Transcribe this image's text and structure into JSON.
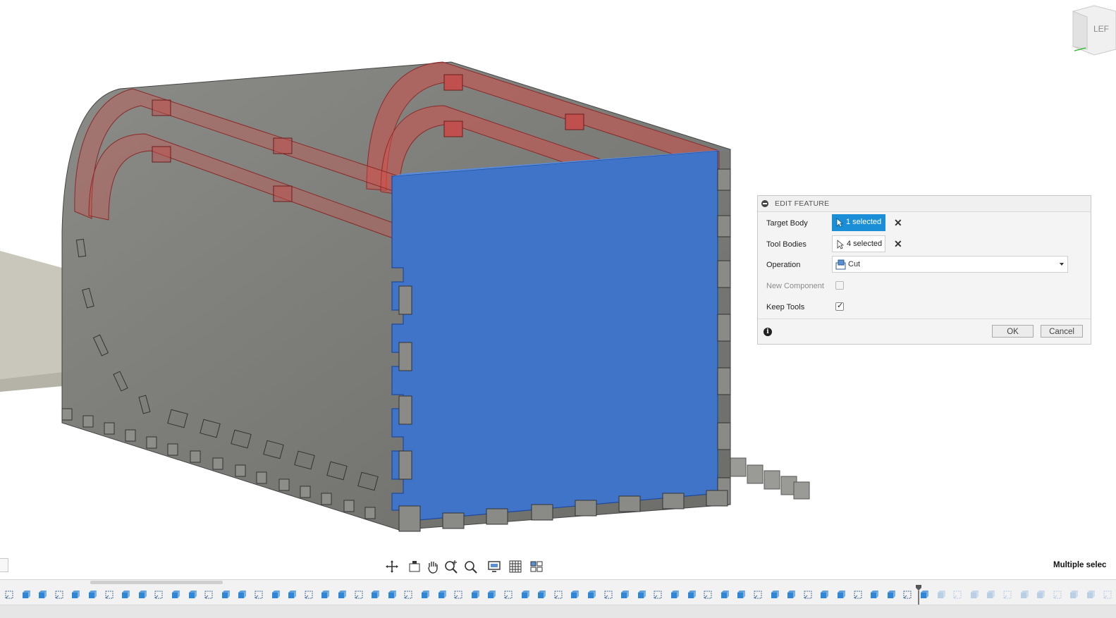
{
  "viewcube": {
    "face_label": "LEF"
  },
  "dialog": {
    "title": "EDIT FEATURE",
    "target_body": {
      "label": "Target Body",
      "value": "1 selected"
    },
    "tool_bodies": {
      "label": "Tool Bodies",
      "value": "4 selected"
    },
    "operation": {
      "label": "Operation",
      "value": "Cut"
    },
    "new_component": {
      "label": "New Component",
      "checked": false,
      "enabled": false
    },
    "keep_tools": {
      "label": "Keep Tools",
      "checked": true,
      "check_glyph": "✓"
    },
    "clear_glyph": "✕",
    "info_glyph": "i",
    "ok_label": "OK",
    "cancel_label": "Cancel"
  },
  "nav_toolbar": {
    "icons": [
      "orbit-icon",
      "look-at-icon",
      "pan-icon",
      "zoom-icon",
      "fit-icon",
      "display-settings-icon",
      "grid-icon",
      "viewports-icon"
    ]
  },
  "status": {
    "text": "Multiple selec"
  },
  "timeline": {
    "icons": [
      "sketch",
      "extrude",
      "body"
    ],
    "colors": {
      "sketch": "#4a6f9c",
      "body": "#2f86d6",
      "suppressed": "#b9cfe6"
    },
    "marker_label": ""
  },
  "model_colors": {
    "target_body": "#3f74c8",
    "tool_bodies": "#c0504d",
    "box": "#7a7a76"
  }
}
